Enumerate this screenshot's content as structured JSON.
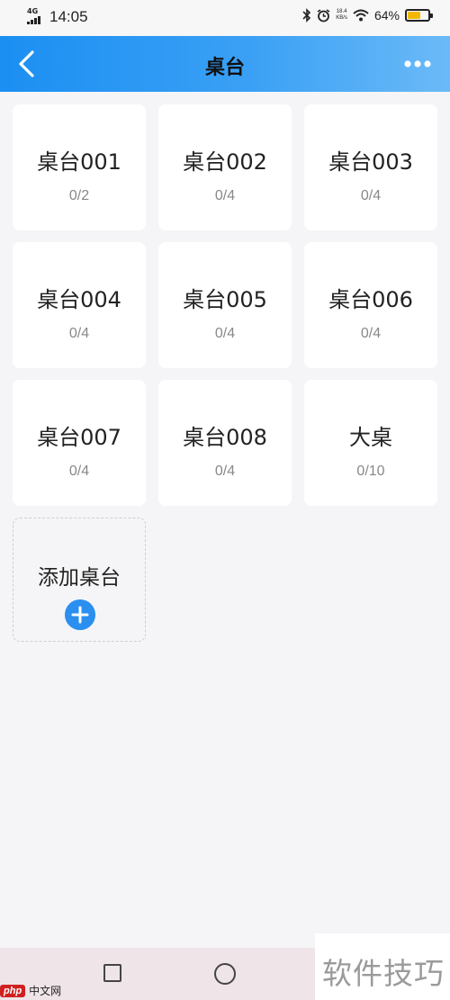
{
  "status_bar": {
    "network": "4G",
    "time": "14:05",
    "net_speed": "18.4",
    "net_speed_unit": "KB/s",
    "battery": "64%",
    "battery_level": 0.64
  },
  "nav": {
    "title": "桌台"
  },
  "tables": [
    {
      "name": "桌台001",
      "seats": "0/2"
    },
    {
      "name": "桌台002",
      "seats": "0/4"
    },
    {
      "name": "桌台003",
      "seats": "0/4"
    },
    {
      "name": "桌台004",
      "seats": "0/4"
    },
    {
      "name": "桌台005",
      "seats": "0/4"
    },
    {
      "name": "桌台006",
      "seats": "0/4"
    },
    {
      "name": "桌台007",
      "seats": "0/4"
    },
    {
      "name": "桌台008",
      "seats": "0/4"
    },
    {
      "name": "大桌",
      "seats": "0/10"
    }
  ],
  "add_table": {
    "label": "添加桌台"
  },
  "watermarks": {
    "php_logo": "php",
    "php_site": "中文网",
    "tips": "软件技巧"
  },
  "colors": {
    "accent": "#2b8ff0",
    "battery": "#f2b800"
  }
}
